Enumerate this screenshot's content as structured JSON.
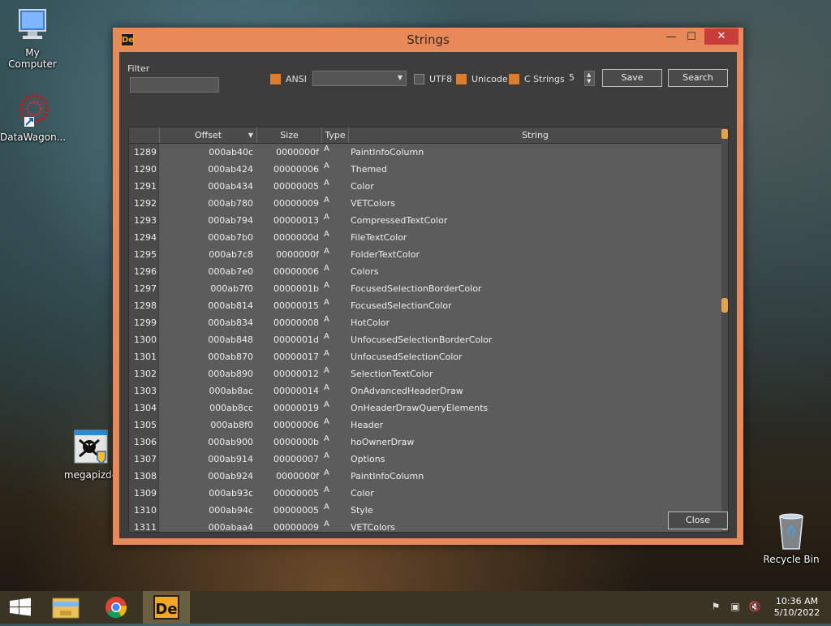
{
  "desktop": {
    "icons": [
      {
        "label": "My Computer",
        "icon": "computer-icon"
      },
      {
        "label": "DataWagon...",
        "icon": "datawagon-icon"
      },
      {
        "label": "megapizde",
        "icon": "megapizde-icon"
      },
      {
        "label": "Recycle Bin",
        "icon": "recycle-bin-icon"
      }
    ]
  },
  "window": {
    "title": "Strings",
    "app_icon": "De",
    "controls": {
      "minimize": "—",
      "maximize": "☐",
      "close": "✕"
    }
  },
  "toolbar": {
    "filter_label": "Filter",
    "filter_value": "",
    "ansi_label": "ANSI",
    "ansi_checked": true,
    "encoding_selected": "",
    "utf8_label": "UTF8",
    "utf8_checked": false,
    "unicode_label": "Unicode",
    "unicode_checked": true,
    "cstrings_label": "C Strings",
    "cstrings_checked": true,
    "min_length": "5",
    "save_label": "Save",
    "search_label": "Search"
  },
  "grid": {
    "columns": [
      "Offset",
      "Size",
      "Type",
      "String"
    ],
    "rows": [
      {
        "idx": "1289",
        "offset": "000ab40c",
        "size": "0000000f",
        "type": "A",
        "string": "PaintInfoColumn"
      },
      {
        "idx": "1290",
        "offset": "000ab424",
        "size": "00000006",
        "type": "A",
        "string": "Themed"
      },
      {
        "idx": "1291",
        "offset": "000ab434",
        "size": "00000005",
        "type": "A",
        "string": "Color"
      },
      {
        "idx": "1292",
        "offset": "000ab780",
        "size": "00000009",
        "type": "A",
        "string": "VETColors"
      },
      {
        "idx": "1293",
        "offset": "000ab794",
        "size": "00000013",
        "type": "A",
        "string": "CompressedTextColor"
      },
      {
        "idx": "1294",
        "offset": "000ab7b0",
        "size": "0000000d",
        "type": "A",
        "string": "FileTextColor"
      },
      {
        "idx": "1295",
        "offset": "000ab7c8",
        "size": "0000000f",
        "type": "A",
        "string": "FolderTextColor"
      },
      {
        "idx": "1296",
        "offset": "000ab7e0",
        "size": "00000006",
        "type": "A",
        "string": "Colors"
      },
      {
        "idx": "1297",
        "offset": "000ab7f0",
        "size": "0000001b",
        "type": "A",
        "string": "FocusedSelectionBorderColor"
      },
      {
        "idx": "1298",
        "offset": "000ab814",
        "size": "00000015",
        "type": "A",
        "string": "FocusedSelectionColor"
      },
      {
        "idx": "1299",
        "offset": "000ab834",
        "size": "00000008",
        "type": "A",
        "string": "HotColor"
      },
      {
        "idx": "1300",
        "offset": "000ab848",
        "size": "0000001d",
        "type": "A",
        "string": "UnfocusedSelectionBorderColor"
      },
      {
        "idx": "1301",
        "offset": "000ab870",
        "size": "00000017",
        "type": "A",
        "string": "UnfocusedSelectionColor"
      },
      {
        "idx": "1302",
        "offset": "000ab890",
        "size": "00000012",
        "type": "A",
        "string": "SelectionTextColor"
      },
      {
        "idx": "1303",
        "offset": "000ab8ac",
        "size": "00000014",
        "type": "A",
        "string": "OnAdvancedHeaderDraw"
      },
      {
        "idx": "1304",
        "offset": "000ab8cc",
        "size": "00000019",
        "type": "A",
        "string": "OnHeaderDrawQueryElements"
      },
      {
        "idx": "1305",
        "offset": "000ab8f0",
        "size": "00000006",
        "type": "A",
        "string": "Header"
      },
      {
        "idx": "1306",
        "offset": "000ab900",
        "size": "0000000b",
        "type": "A",
        "string": "hoOwnerDraw"
      },
      {
        "idx": "1307",
        "offset": "000ab914",
        "size": "00000007",
        "type": "A",
        "string": "Options"
      },
      {
        "idx": "1308",
        "offset": "000ab924",
        "size": "0000000f",
        "type": "A",
        "string": "PaintInfoColumn"
      },
      {
        "idx": "1309",
        "offset": "000ab93c",
        "size": "00000005",
        "type": "A",
        "string": "Color"
      },
      {
        "idx": "1310",
        "offset": "000ab94c",
        "size": "00000005",
        "type": "A",
        "string": "Style"
      },
      {
        "idx": "1311",
        "offset": "000abaa4",
        "size": "00000009",
        "type": "A",
        "string": "VETColors"
      }
    ]
  },
  "footer": {
    "close_label": "Close"
  },
  "taskbar": {
    "items": [
      "windows-start-icon",
      "file-explorer-icon",
      "chrome-icon",
      "de-app-icon"
    ],
    "clock_time": "10:36 AM",
    "clock_date": "5/10/2022"
  },
  "colors": {
    "window_frame": "#e8895a",
    "accent": "#e07b2a",
    "close_red": "#c83c3c"
  }
}
